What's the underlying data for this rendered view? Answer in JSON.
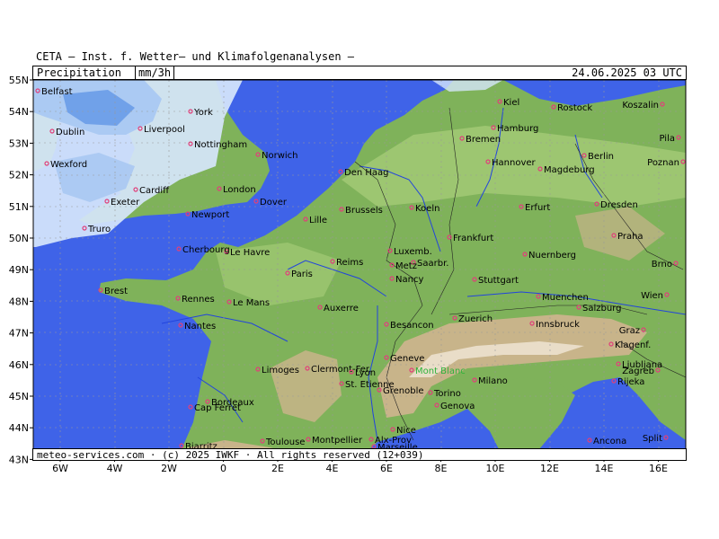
{
  "header": {
    "title": "CETA — Inst. f. Wetter— und Klimafolgenanalysen —",
    "variable": "Precipitation",
    "unit": "mm/3h",
    "datetime": "24.06.2025 03 UTC"
  },
  "footer": {
    "credit": "meteo-services.com · (c) 2025 IWKF · All rights reserved (12+039)"
  },
  "axes": {
    "lat_labels": [
      "55N",
      "54N",
      "53N",
      "52N",
      "51N",
      "50N",
      "49N",
      "48N",
      "47N",
      "46N",
      "45N",
      "44N",
      "43N"
    ],
    "lon_labels": [
      "6W",
      "4W",
      "2W",
      "0",
      "2E",
      "4E",
      "6E",
      "8E",
      "10E",
      "12E",
      "14E",
      "16E"
    ]
  },
  "colors": {
    "sea": "#3f63e8",
    "land": "#7fb25a",
    "lowland": "#a9cf7a",
    "mountain": "#c8b48a",
    "rain_light": "#d6e6fb",
    "rain_medium": "#a9c8f2",
    "rain_heavy": "#6d9ee8",
    "rivers": "#2244dd",
    "cities": "#e0407a"
  },
  "cities": [
    {
      "name": "Belfast"
    },
    {
      "name": "York"
    },
    {
      "name": "Dublin"
    },
    {
      "name": "Liverpool"
    },
    {
      "name": "Nottingham"
    },
    {
      "name": "Wexford"
    },
    {
      "name": "Norwich"
    },
    {
      "name": "Cardiff"
    },
    {
      "name": "London"
    },
    {
      "name": "Exeter"
    },
    {
      "name": "Newport"
    },
    {
      "name": "Dover"
    },
    {
      "name": "Truro"
    },
    {
      "name": "Den Haag"
    },
    {
      "name": "Lille"
    },
    {
      "name": "Brussels"
    },
    {
      "name": "Le Havre"
    },
    {
      "name": "Cherbourg"
    },
    {
      "name": "Brest"
    },
    {
      "name": "Rennes"
    },
    {
      "name": "Le Mans"
    },
    {
      "name": "Paris"
    },
    {
      "name": "Reims"
    },
    {
      "name": "Nantes"
    },
    {
      "name": "Auxerre"
    },
    {
      "name": "Limoges"
    },
    {
      "name": "Clermont-Fer."
    },
    {
      "name": "Bordeaux"
    },
    {
      "name": "Cap Ferret"
    },
    {
      "name": "Biarritz"
    },
    {
      "name": "Toulouse"
    },
    {
      "name": "Montpellier"
    },
    {
      "name": "Kiel"
    },
    {
      "name": "Rostock"
    },
    {
      "name": "Koszalin"
    },
    {
      "name": "Hamburg"
    },
    {
      "name": "Bremen"
    },
    {
      "name": "Pila"
    },
    {
      "name": "Hannover"
    },
    {
      "name": "Berlin"
    },
    {
      "name": "Poznan"
    },
    {
      "name": "Magdeburg"
    },
    {
      "name": "Koeln"
    },
    {
      "name": "Erfurt"
    },
    {
      "name": "Dresden"
    },
    {
      "name": "Frankfurt"
    },
    {
      "name": "Luxemb."
    },
    {
      "name": "Saarbr."
    },
    {
      "name": "Metz"
    },
    {
      "name": "Praha"
    },
    {
      "name": "Nuernberg"
    },
    {
      "name": "Brno"
    },
    {
      "name": "Nancy"
    },
    {
      "name": "Stuttgart"
    },
    {
      "name": "Wien"
    },
    {
      "name": "Muenchen"
    },
    {
      "name": "Salzburg"
    },
    {
      "name": "Besancon"
    },
    {
      "name": "Zuerich"
    },
    {
      "name": "Innsbruck"
    },
    {
      "name": "Graz"
    },
    {
      "name": "Klagenf."
    },
    {
      "name": "Geneve"
    },
    {
      "name": "Mont Blanc"
    },
    {
      "name": "Ljubljana"
    },
    {
      "name": "Lyon"
    },
    {
      "name": "Zagreb"
    },
    {
      "name": "Rijeka"
    },
    {
      "name": "St. Etienne"
    },
    {
      "name": "Grenoble"
    },
    {
      "name": "Torino"
    },
    {
      "name": "Milano"
    },
    {
      "name": "Genova"
    },
    {
      "name": "Nice"
    },
    {
      "name": "Alx-Prov"
    },
    {
      "name": "Marseille"
    },
    {
      "name": "Ancona"
    },
    {
      "name": "Split"
    }
  ]
}
